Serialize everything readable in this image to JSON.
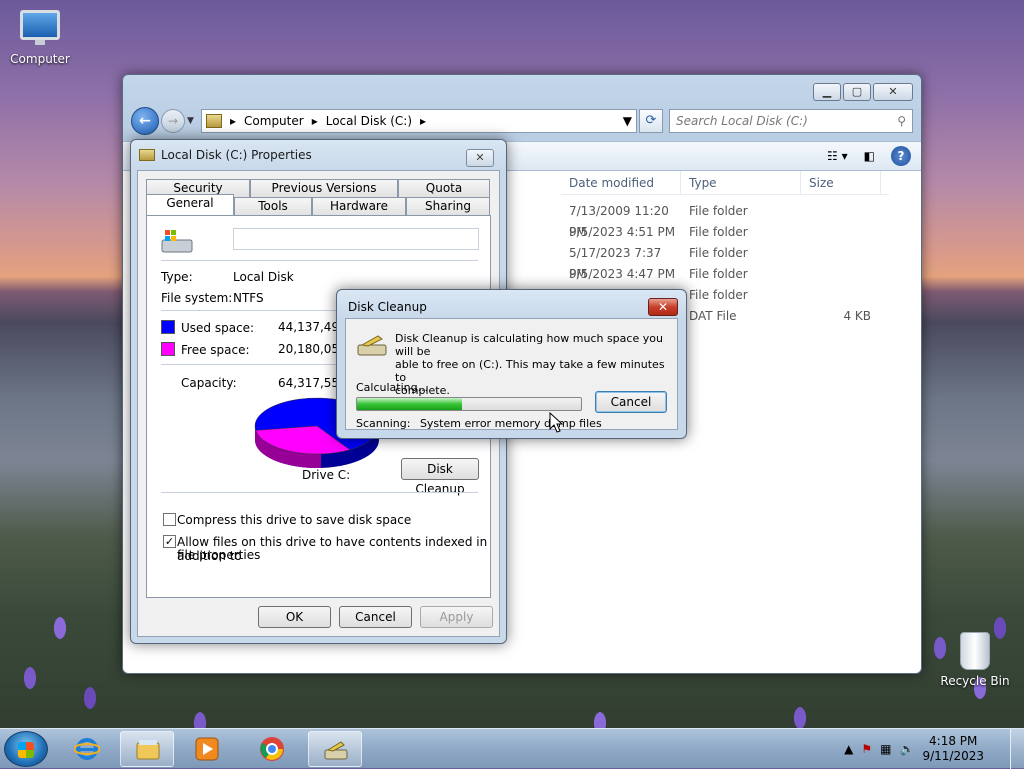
{
  "desktop": {
    "computer_label": "Computer",
    "recycle_label": "Recycle Bin"
  },
  "explorer": {
    "breadcrumb": [
      "Computer",
      "Local Disk (C:)"
    ],
    "search_placeholder": "Search Local Disk (C:)",
    "columns": [
      "Date modified",
      "Type",
      "Size"
    ],
    "rows": [
      {
        "date": "7/13/2009 11:20 PM",
        "type": "File folder",
        "size": ""
      },
      {
        "date": "9/5/2023 4:51 PM",
        "type": "File folder",
        "size": ""
      },
      {
        "date": "5/17/2023 7:37 PM",
        "type": "File folder",
        "size": ""
      },
      {
        "date": "9/5/2023 4:47 PM",
        "type": "File folder",
        "size": ""
      },
      {
        "date": "",
        "type": "File folder",
        "size": ""
      },
      {
        "date": "",
        "type": "DAT File",
        "size": "4 KB"
      }
    ]
  },
  "props": {
    "title": "Local Disk (C:) Properties",
    "tabs_row1": [
      "Security",
      "Previous Versions",
      "Quota"
    ],
    "tabs_row2": [
      "General",
      "Tools",
      "Hardware",
      "Sharing"
    ],
    "type_label": "Type:",
    "type_value": "Local Disk",
    "fs_label": "File system:",
    "fs_value": "NTFS",
    "used_label": "Used space:",
    "used_value": "44,137,492,4",
    "free_label": "Free space:",
    "free_value": "20,180,058,1",
    "capacity_label": "Capacity:",
    "capacity_value": "64,317,550,5",
    "drive_label": "Drive C:",
    "cleanup_button": "Disk Cleanup",
    "compress_label": "Compress this drive to save disk space",
    "index_label_1": "Allow files on this drive to have contents indexed in addition to",
    "index_label_2": "file properties",
    "ok": "OK",
    "cancel": "Cancel",
    "apply": "Apply",
    "used_color": "#0000ff",
    "free_color": "#ff00ff",
    "used_fraction": 0.686
  },
  "cleanup": {
    "title": "Disk Cleanup",
    "message_1": "Disk Cleanup is calculating how much space you will be",
    "message_2": "able to free on  (C:). This may take a few minutes to",
    "message_3": "complete.",
    "calculating": "Calculating...",
    "cancel": "Cancel",
    "scanning_label": "Scanning:",
    "scanning_value": "System error memory dump files",
    "progress_fraction": 0.47
  },
  "taskbar": {
    "time": "4:18 PM",
    "date": "9/11/2023"
  }
}
